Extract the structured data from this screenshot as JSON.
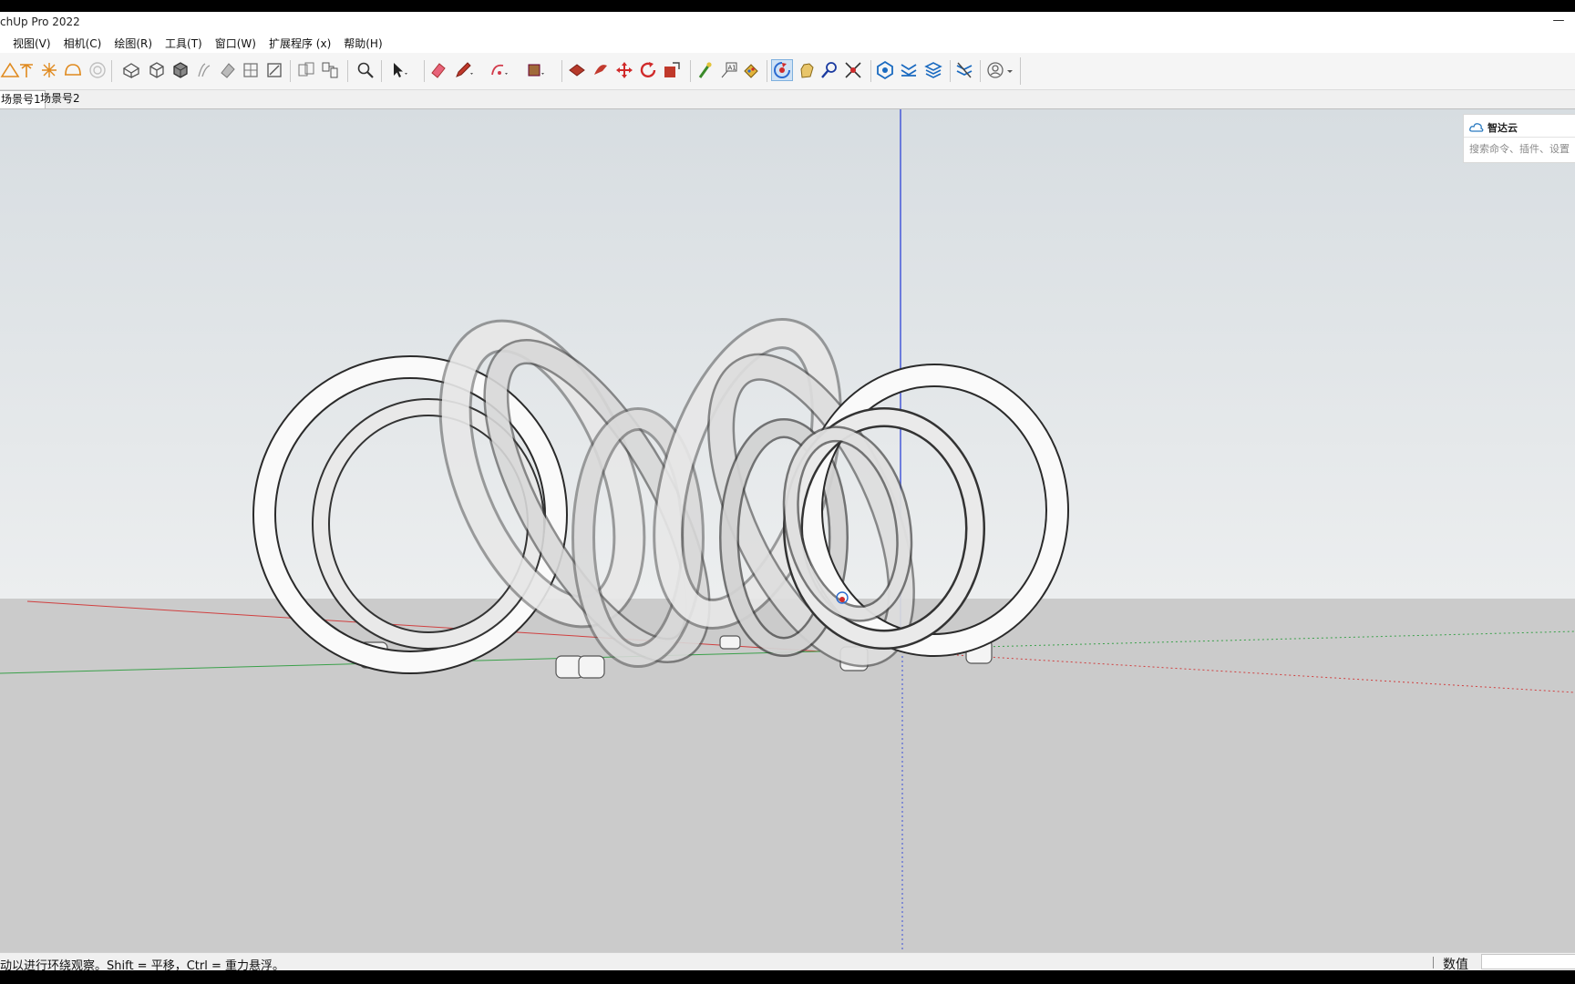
{
  "window": {
    "title": "chUp Pro 2022",
    "minimize_symbol": "—"
  },
  "menu": [
    "视图(V)",
    "相机(C)",
    "绘图(R)",
    "工具(T)",
    "窗口(W)",
    "扩展程序 (x)",
    "帮助(H)"
  ],
  "toolbar": {
    "icons": [
      "protractor-icon",
      "axes-icon",
      "section-plane-icon",
      "hard-hat-icon",
      "target-icon",
      "standard-views-icon",
      "iso-view-icon",
      "top-view-icon",
      "front-view-icon",
      "right-view-icon",
      "back-view-icon",
      "left-view-icon",
      "group-icon",
      "component-icon",
      "zoom-icon",
      "select-icon",
      "eraser-icon",
      "pencil-icon",
      "arc-icon",
      "rectangle-icon",
      "push-pull-icon",
      "follow-me-icon",
      "move-icon",
      "rotate-icon",
      "scale-icon",
      "tape-measure-icon",
      "text-icon",
      "paint-bucket-icon",
      "orbit-icon",
      "pan-icon",
      "zoom-tool-icon",
      "zoom-extents-icon",
      "warehouse-icon",
      "extension-icon",
      "layers-icon",
      "styles-icon",
      "account-icon"
    ],
    "active_tool": "orbit-icon"
  },
  "scenes": [
    "场景号1",
    "场景号2"
  ],
  "selected_scene": "场景号1",
  "cloud_panel": {
    "title": "智达云",
    "search_placeholder": "搜索命令、插件、设置"
  },
  "status": {
    "hint": "动以进行环绕观察。Shift = 平移，Ctrl = 重力悬浮。",
    "vcb_label": "数值",
    "vcb_value": ""
  },
  "colors": {
    "sky": "#e3e6e8",
    "ground": "#cbcbcb",
    "axis_red": "#d04040",
    "axis_green": "#3aa04a",
    "axis_blue": "#3b4fd8",
    "active_tool_bg": "#cfe2f5"
  }
}
